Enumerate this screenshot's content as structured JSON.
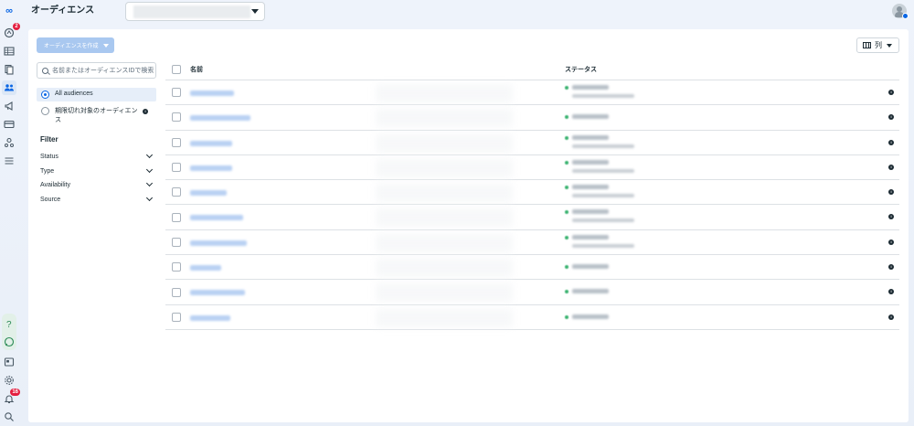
{
  "rail": {
    "logo": "∞",
    "notifications_badge": "2",
    "alerts_badge": "16"
  },
  "header": {
    "title": "オーディエンス",
    "account_value": ""
  },
  "toolbar": {
    "create_label": "オーディエンスを作成",
    "columns_label": "列"
  },
  "sidebar": {
    "search_placeholder": "名前またはオーディエンスIDで検索",
    "radio_options": [
      {
        "label": "All audiences",
        "selected": true
      },
      {
        "label": "期限切れ対象のオーディエンス",
        "selected": false
      }
    ],
    "filter_title": "Filter",
    "filters": [
      "Status",
      "Type",
      "Availability",
      "Source"
    ]
  },
  "table": {
    "headers": {
      "name": "名前",
      "status": "ステータス"
    },
    "rows": [
      {
        "name": "",
        "status": "",
        "status_detail": ""
      },
      {
        "name": "",
        "status": "",
        "status_detail": ""
      },
      {
        "name": "",
        "status": "",
        "status_detail": ""
      },
      {
        "name": "",
        "status": "",
        "status_detail": ""
      },
      {
        "name": "",
        "status": "",
        "status_detail": ""
      },
      {
        "name": "",
        "status": "",
        "status_detail": ""
      },
      {
        "name": "",
        "status": "",
        "status_detail": ""
      },
      {
        "name": "",
        "status": "",
        "status_detail": ""
      },
      {
        "name": "",
        "status": "",
        "status_detail": ""
      },
      {
        "name": "",
        "status": "",
        "status_detail": ""
      }
    ]
  },
  "colors": {
    "accent": "#0a66e4",
    "badge": "#e41e3f",
    "create_button": "#a9c8f0",
    "selected_row": "#e6eef9"
  }
}
